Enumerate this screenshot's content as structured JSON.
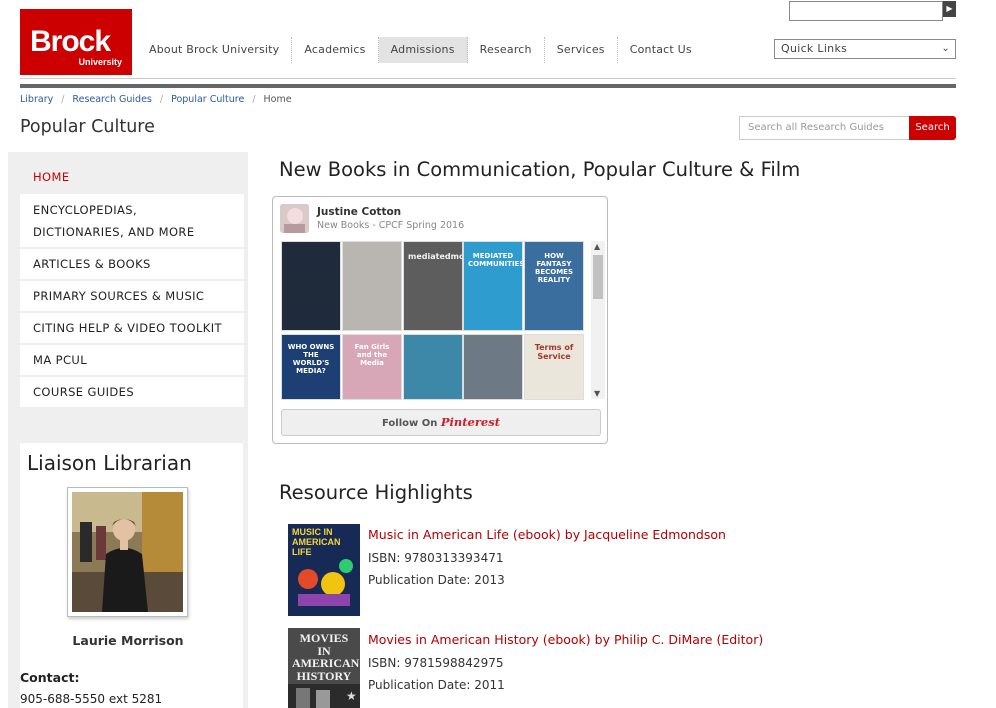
{
  "header": {
    "logo_main": "Brock",
    "logo_sub": "University",
    "nav": [
      "About Brock University",
      "Academics",
      "Admissions",
      "Research",
      "Services",
      "Contact Us"
    ],
    "nav_active_index": 2,
    "quick_links": "Quick Links",
    "top_search_value": ""
  },
  "breadcrumb": [
    "Library",
    "Research Guides",
    "Popular Culture",
    "Home"
  ],
  "page_title": "Popular Culture",
  "guide_search": {
    "placeholder": "Search all Research Guides",
    "button": "Search"
  },
  "sidebar": {
    "items": [
      "HOME",
      "ENCYCLOPEDIAS, DICTIONARIES, AND MORE",
      "ARTICLES & BOOKS",
      "PRIMARY SOURCES & MUSIC",
      "CITING HELP & VIDEO TOOLKIT",
      "MA PCUL",
      "COURSE GUIDES"
    ],
    "active_index": 0
  },
  "liaison": {
    "title": "Liaison Librarian",
    "name": "Laurie Morrison",
    "contact_label": "Contact:",
    "phone": "905-688-5550 ext 5281"
  },
  "new_books": {
    "title": "New Books in Communication, Popular Culture & Film",
    "widget": {
      "user": "Justine Cotton",
      "board": "New Books - CPCF Spring 2016",
      "follow_label": "Follow On",
      "follow_brand": "Pinterest",
      "pins": [
        {
          "caption": "",
          "bg": "#1f2a3a",
          "fg": "#cfd6e0"
        },
        {
          "caption": "",
          "bg": "#b9b5b0",
          "fg": "#333333"
        },
        {
          "caption": "mediatedmoms",
          "bg": "#5d5d5d",
          "fg": "#f2f2f2"
        },
        {
          "caption": "MEDIATED COMMUNITIES",
          "bg": "#2e9ccf",
          "fg": "#ffffff"
        },
        {
          "caption": "HOW FANTASY BECOMES REALITY",
          "bg": "#3a6e9e",
          "fg": "#ffffff"
        },
        {
          "caption": "WHO OWNS THE WORLD'S MEDIA?",
          "bg": "#1d3f74",
          "fg": "#ffffff"
        },
        {
          "caption": "Fan Girls and the Media",
          "bg": "#d7a7b8",
          "fg": "#ffffff"
        },
        {
          "caption": "",
          "bg": "#3d87a8",
          "fg": "#ffffff"
        },
        {
          "caption": "",
          "bg": "#6d7a86",
          "fg": "#ffffff"
        },
        {
          "caption": "Terms of Service",
          "bg": "#ebe6dc",
          "fg": "#a3382a"
        }
      ]
    }
  },
  "resources": {
    "title": "Resource Highlights",
    "items": [
      {
        "title": "Music in American Life (ebook) by Jacqueline Edmondson",
        "isbn": "ISBN: 9780313393471",
        "date": "Publication Date: 2013",
        "cover_caption": "MUSIC IN AMERICAN LIFE",
        "cover_bg": "#162a55"
      },
      {
        "title": "Movies in American History (ebook) by Philip C. DiMare (Editor)",
        "isbn": "ISBN: 9781598842975",
        "date": "Publication Date: 2011",
        "cover_caption": "MOVIES IN AMERICAN HISTORY",
        "cover_bg": "#4a4a4a"
      }
    ]
  }
}
